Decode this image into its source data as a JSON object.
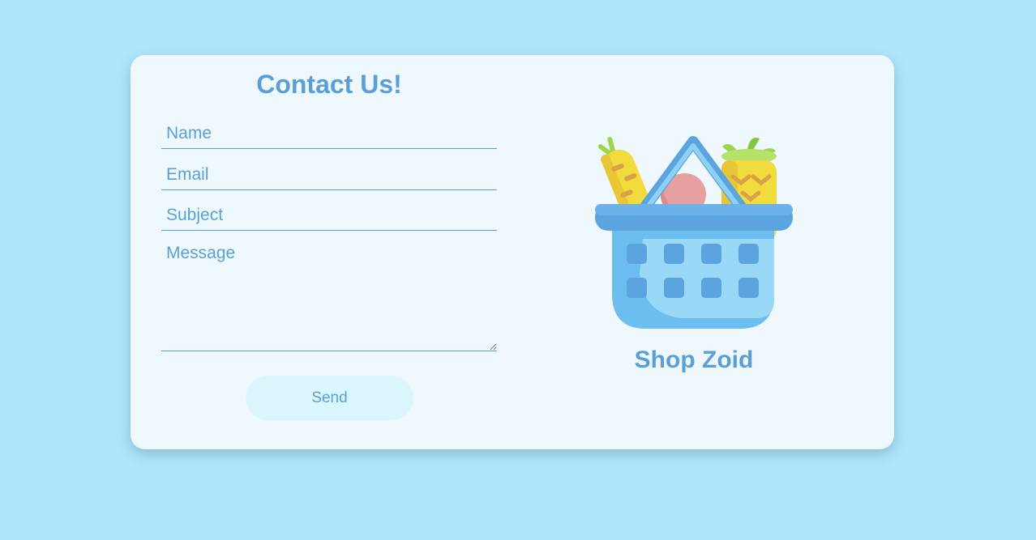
{
  "form": {
    "title": "Contact Us!",
    "name_placeholder": "Name",
    "email_placeholder": "Email",
    "subject_placeholder": "Subject",
    "message_placeholder": "Message",
    "send_label": "Send"
  },
  "brand": {
    "name": "Shop Zoid",
    "logo_icon": "grocery-basket-icon"
  },
  "colors": {
    "page_background": "#afe6fc",
    "card_background": "#eff9fd",
    "accent": "#5aa0d6",
    "button_background": "#dbf7fd"
  }
}
